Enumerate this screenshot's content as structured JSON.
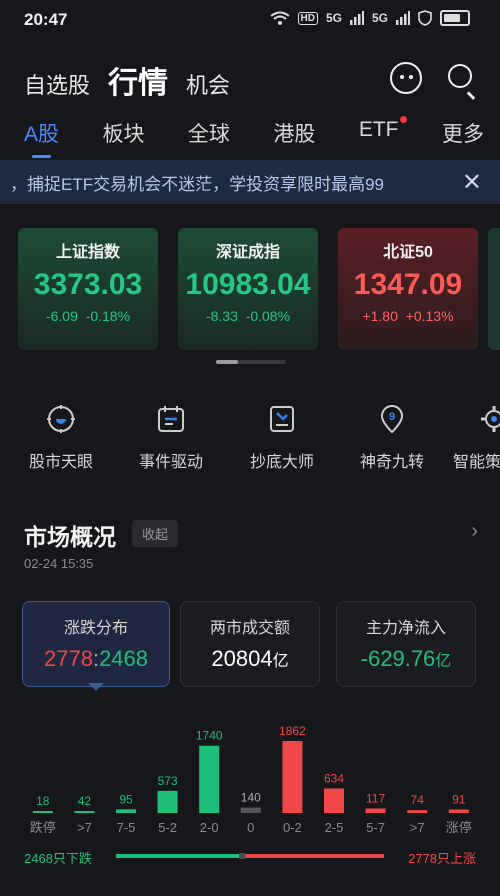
{
  "status": {
    "time": "20:47",
    "icons": [
      "wifi-icon",
      "hd-icon",
      "signal-5g-1",
      "signal-5g-2",
      "shield-icon",
      "battery-icon"
    ],
    "labels": [
      "HD",
      "5G",
      "5G"
    ]
  },
  "top_nav": {
    "items": [
      "自选股",
      "行情",
      "机会"
    ],
    "active": "行情"
  },
  "market_tabs": [
    "A股",
    "板块",
    "全球",
    "港股",
    "ETF",
    "更多"
  ],
  "banner": {
    "text": "，捕捉ETF交易机会不迷茫，学投资享限时最高99",
    "close": "✕"
  },
  "indices": [
    {
      "name": "上证指数",
      "value": "3373.03",
      "change": "-6.09",
      "pct": "-0.18%",
      "color": "green"
    },
    {
      "name": "深证成指",
      "value": "10983.04",
      "change": "-8.33",
      "pct": "-0.08%",
      "color": "green"
    },
    {
      "name": "北证50",
      "value": "1347.09",
      "change": "+1.80",
      "pct": "+0.13%",
      "color": "red"
    }
  ],
  "tools": [
    {
      "label": "股市天眼",
      "icon": "eye-target-icon"
    },
    {
      "label": "事件驱动",
      "icon": "calendar-icon"
    },
    {
      "label": "抄底大师",
      "icon": "bottom-fishing-icon"
    },
    {
      "label": "神奇九转",
      "icon": "nine-pin-icon"
    },
    {
      "label": "智能策",
      "icon": "gear-icon"
    }
  ],
  "overview": {
    "title": "市场概况",
    "collapse": "收起",
    "time": "02-24 15:35",
    "stats": [
      {
        "title": "涨跌分布",
        "value_up": "2778",
        "sep": ":",
        "value_down": "2468"
      },
      {
        "title": "两市成交额",
        "value": "20804",
        "unit": "亿"
      },
      {
        "title": "主力净流入",
        "value": "-629.76",
        "unit": "亿"
      }
    ]
  },
  "colors": {
    "up": "#f04848",
    "down": "#1fbf7a",
    "flat": "#8a8a8a",
    "accent": "#4a8cff"
  },
  "chart_data": {
    "type": "bar",
    "categories": [
      "跌停",
      ">7",
      "7-5",
      "5-2",
      "2-0",
      "0",
      "0-2",
      "2-5",
      "5-7",
      ">7",
      "涨停"
    ],
    "values": [
      18,
      42,
      95,
      573,
      1740,
      140,
      1862,
      634,
      117,
      74,
      91
    ],
    "colors": [
      "green",
      "green",
      "green",
      "green",
      "green",
      "gray",
      "red",
      "red",
      "red",
      "red",
      "red"
    ],
    "down_label": "2468只下跌",
    "up_label": "2778只上涨",
    "down_total": 2468,
    "up_total": 2778
  }
}
